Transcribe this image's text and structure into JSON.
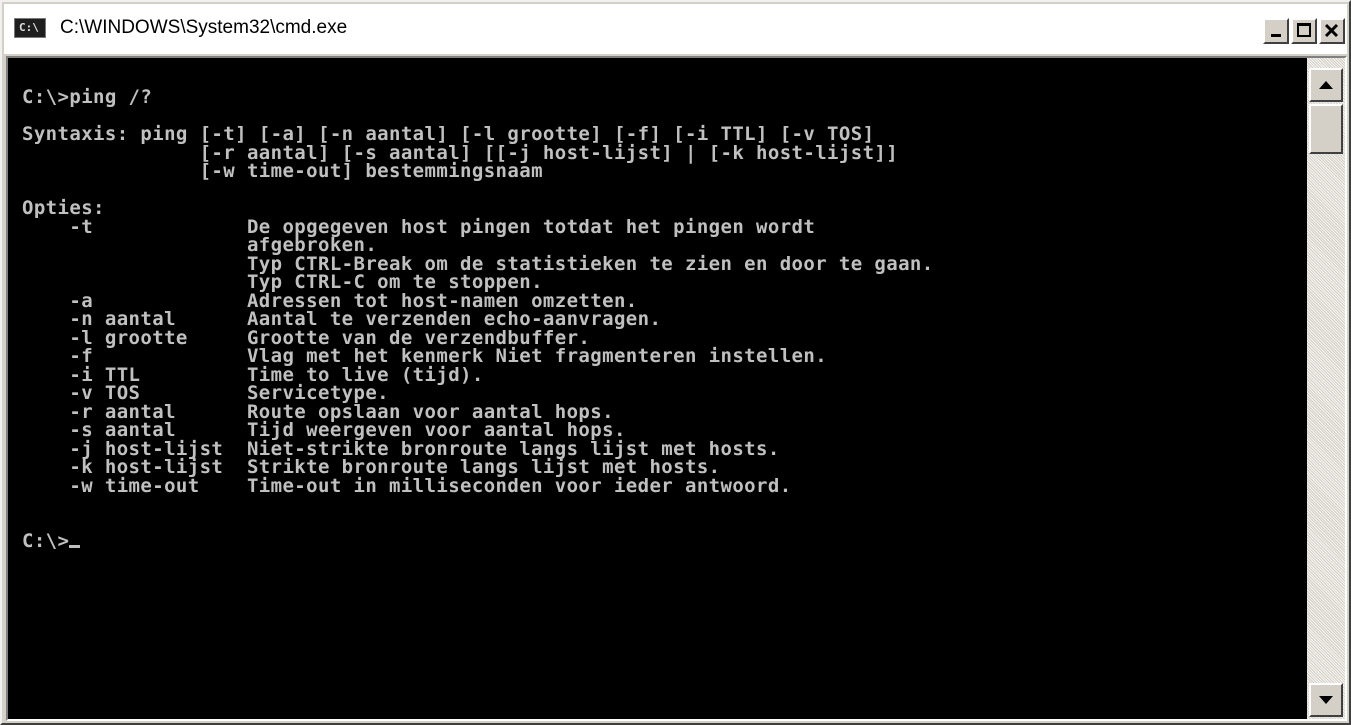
{
  "window": {
    "title": "C:\\WINDOWS\\System32\\cmd.exe",
    "icon_label": "C:\\",
    "icon": "cmd-icon",
    "buttons": [
      "minimize-icon",
      "maximize-icon",
      "close-icon"
    ]
  },
  "console": {
    "lines": [
      "C:\\>ping /?",
      "",
      "Syntaxis: ping [-t] [-a] [-n aantal] [-l grootte] [-f] [-i TTL] [-v TOS]",
      "               [-r aantal] [-s aantal] [[-j host-lijst] | [-k host-lijst]]",
      "               [-w time-out] bestemmingsnaam",
      "",
      "Opties:",
      "    -t             De opgegeven host pingen totdat het pingen wordt",
      "                   afgebroken.",
      "                   Typ CTRL-Break om de statistieken te zien en door te gaan.",
      "                   Typ CTRL-C om te stoppen.",
      "    -a             Adressen tot host-namen omzetten.",
      "    -n aantal      Aantal te verzenden echo-aanvragen.",
      "    -l grootte     Grootte van de verzendbuffer.",
      "    -f             Vlag met het kenmerk Niet fragmenteren instellen.",
      "    -i TTL         Time to live (tijd).",
      "    -v TOS         Servicetype.",
      "    -r aantal      Route opslaan voor aantal hops.",
      "    -s aantal      Tijd weergeven voor aantal hops.",
      "    -j host-lijst  Niet-strikte bronroute langs lijst met hosts.",
      "    -k host-lijst  Strikte bronroute langs lijst met hosts.",
      "    -w time-out    Time-out in milliseconden voor ieder antwoord.",
      "",
      ""
    ],
    "prompt": "C:\\>"
  },
  "colors": {
    "console_bg": "#000000",
    "console_fg": "#C0C0C0",
    "chrome": "#D4D0C8"
  }
}
